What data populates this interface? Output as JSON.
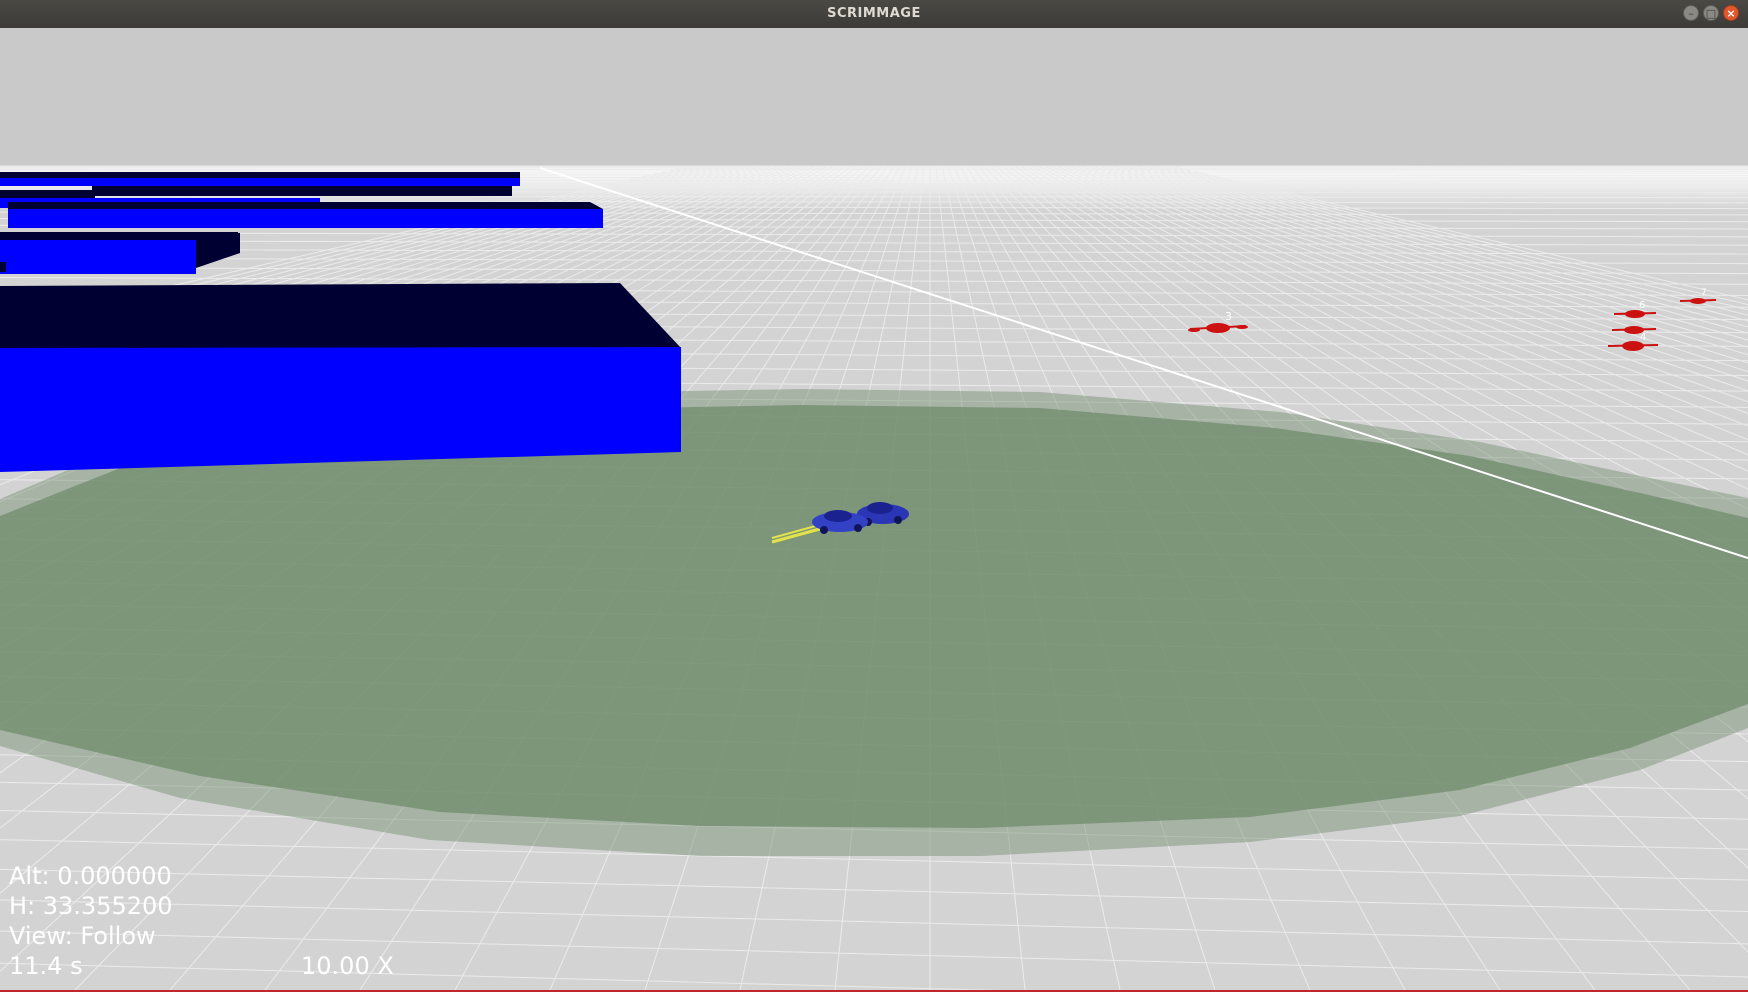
{
  "window": {
    "title": "SCRIMMAGE",
    "controls": {
      "minimize_icon": "minimize-icon",
      "maximize_icon": "maximize-icon",
      "close_icon": "close-icon"
    }
  },
  "scene": {
    "colors": {
      "sky": "#c9c9c9",
      "ground": "#d3d3d3",
      "grid_lines": "#ebebeb",
      "buildings": "#0000ff",
      "building_tops": "#000033",
      "team_blue": "#2a36b5",
      "team_red": "#cc1111",
      "boundary_zone": "#6f8c6c",
      "trail": "#e2e24a"
    },
    "entity_labels": [
      "3",
      "6",
      "4",
      "7"
    ]
  },
  "hud": {
    "altitude": "Alt: 0.000000",
    "heading": "H: 33.355200",
    "view_mode": "View: Follow",
    "sim_time": "11.4 s",
    "time_warp": "10.00 X"
  }
}
